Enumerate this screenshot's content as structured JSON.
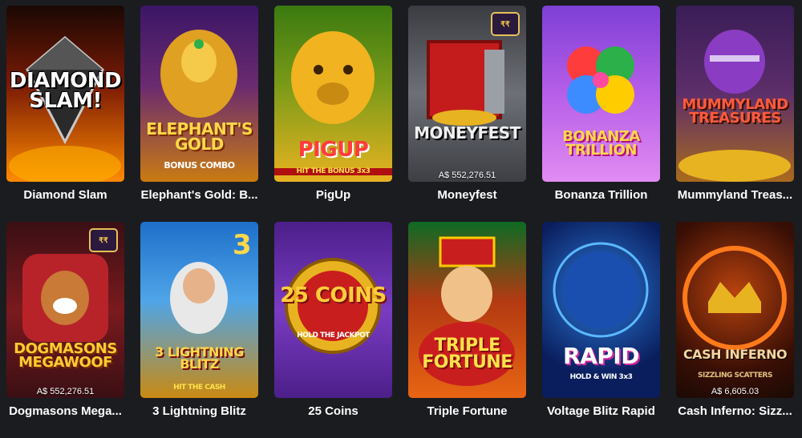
{
  "games": [
    {
      "title": "Diamond Slam",
      "logo": "DIAMOND SLAM!",
      "sub": "",
      "jackpot": "",
      "bg": "#7a1a05",
      "bg2": "#ff8a00",
      "logo_color": "#ffffff"
    },
    {
      "title": "Elephant's Gold: B...",
      "logo": "ELEPHANT'S GOLD",
      "sub": "BONUS COMBO",
      "jackpot": "",
      "bg": "#3b1666",
      "bg2": "#c97b12",
      "logo_color": "#ffd84a"
    },
    {
      "title": "PigUp",
      "logo": "PIGUP",
      "sub": "HIT THE BONUS 3x3",
      "jackpot": "",
      "bg": "#3b7a10",
      "bg2": "#e8b321",
      "logo_color": "#ff3c3c"
    },
    {
      "title": "Moneyfest",
      "logo": "MONEYFEST",
      "sub": "",
      "jackpot": "A$ 552,276.51",
      "bg": "#3a3c42",
      "bg2": "#8f9298",
      "logo_color": "#f0f0f0"
    },
    {
      "title": "Bonanza Trillion",
      "logo": "BONANZA TRILLION",
      "sub": "",
      "jackpot": "",
      "bg": "#7e3fd6",
      "bg2": "#e18cf2",
      "logo_color": "#ffd84a"
    },
    {
      "title": "Mummyland Treas...",
      "logo": "MUMMYLAND TREASURES",
      "sub": "",
      "jackpot": "",
      "bg": "#3a1d57",
      "bg2": "#a96a1d",
      "logo_color": "#ff5a3c"
    },
    {
      "title": "Dogmasons Mega...",
      "logo": "DOGMASONS MEGAWOOF",
      "sub": "",
      "jackpot": "A$ 552,276.51",
      "bg": "#3a0f14",
      "bg2": "#b8232a",
      "logo_color": "#ffcc33"
    },
    {
      "title": "3 Lightning Blitz",
      "logo": "3 LIGHTNING BLITZ",
      "sub": "HIT THE CASH",
      "jackpot": "",
      "bg": "#1e6fc9",
      "bg2": "#8ad4ff",
      "logo_color": "#ffd84a"
    },
    {
      "title": "25 Coins",
      "logo": "25 COINS",
      "sub": "HOLD THE JACKPOT",
      "jackpot": "",
      "bg": "#4c1f8a",
      "bg2": "#9b4fe0",
      "logo_color": "#ffcf3a"
    },
    {
      "title": "Triple Fortune",
      "logo": "TRIPLE FORTUNE",
      "sub": "",
      "jackpot": "",
      "bg": "#0d6b24",
      "bg2": "#e86513",
      "logo_color": "#ffe14a"
    },
    {
      "title": "Voltage Blitz Rapid",
      "logo": "RAPID",
      "sub": "HOLD & WIN 3x3",
      "jackpot": "",
      "bg": "#0a1d5c",
      "bg2": "#2b7bd9",
      "logo_color": "#ffffff"
    },
    {
      "title": "Cash Inferno: Sizz...",
      "logo": "CASH INFERNO",
      "sub": "SIZZLING SCATTERS",
      "jackpot": "A$ 6,605.03",
      "bg": "#1a0a05",
      "bg2": "#b8420e",
      "logo_color": "#f0d7a0"
    }
  ]
}
